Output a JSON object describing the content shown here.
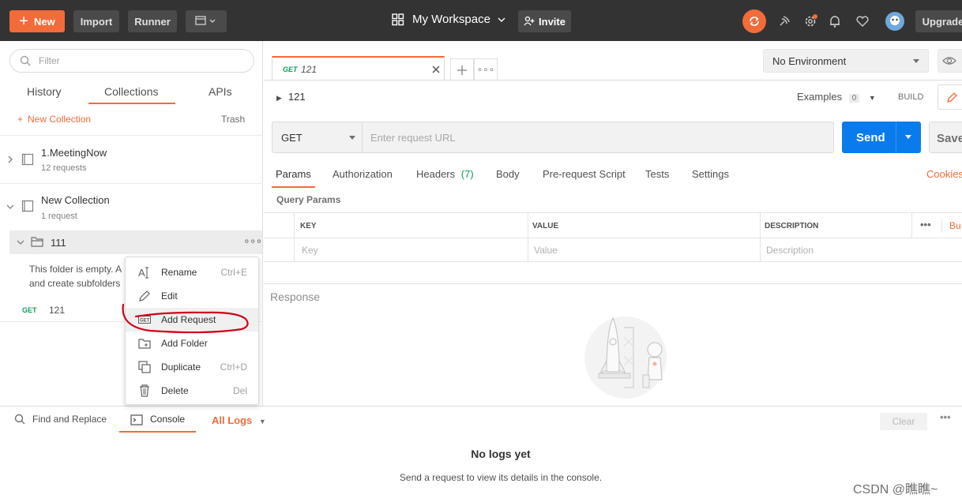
{
  "topbar": {
    "new_label": "New",
    "import_label": "Import",
    "runner_label": "Runner",
    "workspace_label": "My Workspace",
    "invite_label": "Invite",
    "upgrade_label": "Upgrade"
  },
  "sidebar": {
    "filter_placeholder": "Filter",
    "tabs": [
      {
        "label": "History"
      },
      {
        "label": "Collections"
      },
      {
        "label": "APIs"
      }
    ],
    "new_collection_label": "New Collection",
    "trash_label": "Trash",
    "collections": [
      {
        "name": "1.MeetingNow",
        "count": "12 requests"
      },
      {
        "name": "New Collection",
        "count": "1 request"
      }
    ],
    "folder": {
      "name": "111",
      "empty_text_line1": "This folder is empty. A",
      "empty_text_line2": "and create subfolders"
    },
    "request": {
      "method": "GET",
      "name": "121"
    }
  },
  "context_menu": {
    "items": [
      {
        "label": "Rename",
        "shortcut": "Ctrl+E"
      },
      {
        "label": "Edit",
        "shortcut": ""
      },
      {
        "label": "Add Request",
        "shortcut": ""
      },
      {
        "label": "Add Folder",
        "shortcut": ""
      },
      {
        "label": "Duplicate",
        "shortcut": "Ctrl+D"
      },
      {
        "label": "Delete",
        "shortcut": "Del"
      }
    ]
  },
  "main": {
    "tab": {
      "method": "GET",
      "name": "121"
    },
    "environment": "No Environment",
    "request_name": "121",
    "examples_label": "Examples",
    "examples_count": "0",
    "build_label": "BUILD",
    "method": "GET",
    "url_placeholder": "Enter request URL",
    "send_label": "Send",
    "save_label": "Save",
    "param_tabs": [
      {
        "label": "Params"
      },
      {
        "label": "Authorization"
      },
      {
        "label": "Headers"
      },
      {
        "label": "Body"
      },
      {
        "label": "Pre-request Script"
      },
      {
        "label": "Tests"
      },
      {
        "label": "Settings"
      }
    ],
    "headers_count": "(7)",
    "cookies_label": "Cookies",
    "query_params_label": "Query Params",
    "table": {
      "headers": [
        "KEY",
        "VALUE",
        "DESCRIPTION"
      ],
      "placeholders": [
        "Key",
        "Value",
        "Description"
      ],
      "bulk_label": "Bu"
    },
    "response_label": "Response"
  },
  "console": {
    "find_replace_label": "Find and Replace",
    "console_label": "Console",
    "all_logs_label": "All Logs",
    "clear_label": "Clear",
    "no_logs_title": "No logs yet",
    "no_logs_sub": "Send a request to view its details in the console."
  },
  "watermark": "CSDN @瞧瞧~",
  "colors": {
    "accent": "#f26b3a",
    "send_blue": "#097bed",
    "get_green": "#0f9d58",
    "topbar": "#333333",
    "annotation_red": "#d0021b"
  }
}
